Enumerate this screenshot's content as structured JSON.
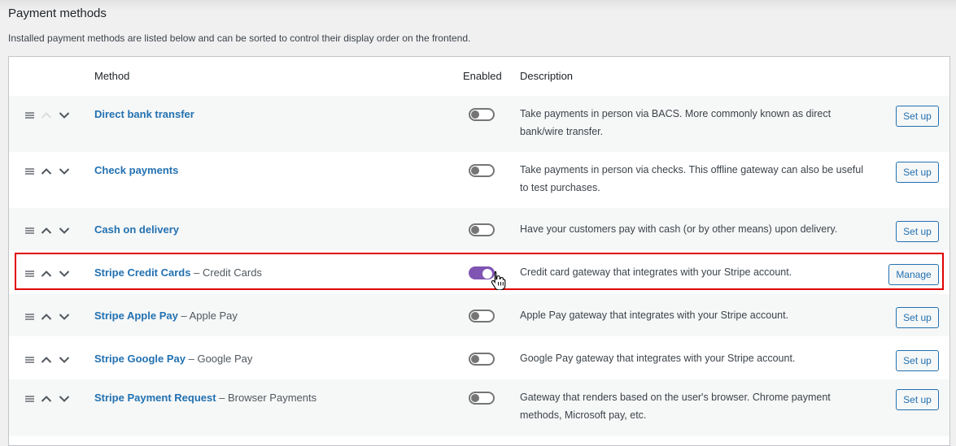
{
  "page": {
    "title": "Payment methods",
    "description": "Installed payment methods are listed below and can be sorted to control their display order on the frontend."
  },
  "table": {
    "headers": {
      "method": "Method",
      "enabled": "Enabled",
      "description": "Description"
    },
    "rows": [
      {
        "name": "Direct bank transfer",
        "subtitle": "",
        "enabled": false,
        "description": "Take payments in person via BACS. More commonly known as direct bank/wire transfer.",
        "action": "Set up",
        "highlighted": false
      },
      {
        "name": "Check payments",
        "subtitle": "",
        "enabled": false,
        "description": "Take payments in person via checks. This offline gateway can also be useful to test purchases.",
        "action": "Set up",
        "highlighted": false
      },
      {
        "name": "Cash on delivery",
        "subtitle": "",
        "enabled": false,
        "description": "Have your customers pay with cash (or by other means) upon delivery.",
        "action": "Set up",
        "highlighted": false
      },
      {
        "name": "Stripe Credit Cards",
        "subtitle": "Credit Cards",
        "enabled": true,
        "description": "Credit card gateway that integrates with your Stripe account.",
        "action": "Manage",
        "highlighted": true
      },
      {
        "name": "Stripe Apple Pay",
        "subtitle": "Apple Pay",
        "enabled": false,
        "description": "Apple Pay gateway that integrates with your Stripe account.",
        "action": "Set up",
        "highlighted": false
      },
      {
        "name": "Stripe Google Pay",
        "subtitle": "Google Pay",
        "enabled": false,
        "description": "Google Pay gateway that integrates with your Stripe account.",
        "action": "Set up",
        "highlighted": false
      },
      {
        "name": "Stripe Payment Request",
        "subtitle": "Browser Payments",
        "enabled": false,
        "description": "Gateway that renders based on the user's browser. Chrome payment methods, Microsoft pay, etc.",
        "action": "Set up",
        "highlighted": false
      }
    ]
  },
  "colors": {
    "link": "#2271b1",
    "toggle_on": "#7f54b3",
    "toggle_off": "#757575",
    "highlight": "#e00000"
  },
  "icons": {
    "handle": "drag-handle-icon",
    "up": "chevron-up-icon",
    "down": "chevron-down-icon",
    "cursor": "hand-pointer-cursor-icon"
  }
}
